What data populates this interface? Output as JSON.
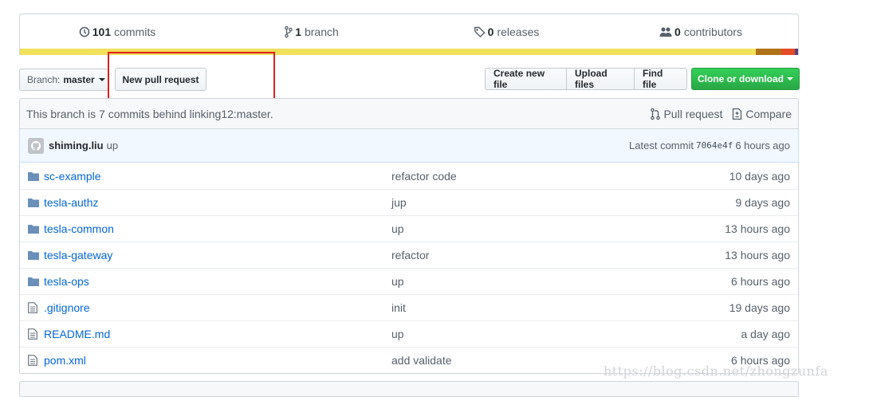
{
  "summary": {
    "commits": {
      "num": "101",
      "label": "commits",
      "icon": "history-icon"
    },
    "branch": {
      "num": "1",
      "label": "branch",
      "icon": "git-branch-icon"
    },
    "releases": {
      "num": "0",
      "label": "releases",
      "icon": "tag-icon"
    },
    "contributors": {
      "num": "0",
      "label": "contributors",
      "icon": "people-icon"
    },
    "language_colors": [
      "#f1e05a",
      "#b07219",
      "#e34c26",
      "#563d7c"
    ]
  },
  "toolbar": {
    "branch_label": "Branch:",
    "branch_value": "master",
    "new_pr": "New pull request",
    "create_file": "Create new file",
    "upload_files": "Upload files",
    "find_file": "Find file",
    "clone": "Clone or download"
  },
  "compare": {
    "status": "This branch is 7 commits behind linking12:master.",
    "pull_request": "Pull request",
    "compare": "Compare"
  },
  "commit": {
    "author": "shiming.liu",
    "message": "up",
    "latest_label": "Latest commit",
    "sha": "7064e4f",
    "age": "6 hours ago"
  },
  "files": [
    {
      "type": "dir",
      "name": "sc-example",
      "msg": "refactor code",
      "age": "10 days ago"
    },
    {
      "type": "dir",
      "name": "tesla-authz",
      "msg": "jup",
      "age": "9 days ago"
    },
    {
      "type": "dir",
      "name": "tesla-common",
      "msg": "up",
      "age": "13 hours ago"
    },
    {
      "type": "dir",
      "name": "tesla-gateway",
      "msg": "refactor",
      "age": "13 hours ago"
    },
    {
      "type": "dir",
      "name": "tesla-ops",
      "msg": "up",
      "age": "6 hours ago"
    },
    {
      "type": "file",
      "name": ".gitignore",
      "msg": "init",
      "age": "19 days ago"
    },
    {
      "type": "file",
      "name": "README.md",
      "msg": "up",
      "age": "a day ago"
    },
    {
      "type": "file",
      "name": "pom.xml",
      "msg": "add validate",
      "age": "6 hours ago"
    }
  ],
  "watermark": "https://blog.csdn.net/zhongzunfa"
}
